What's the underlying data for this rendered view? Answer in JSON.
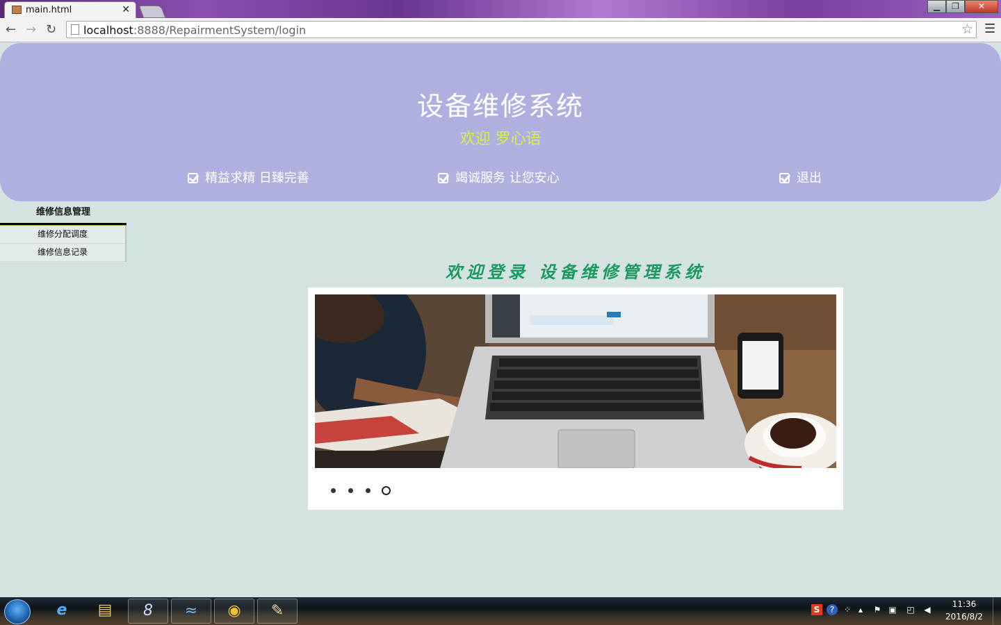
{
  "browser": {
    "tab_title": "main.html",
    "url_host": "localhost",
    "url_rest": ":8888/RepairmentSystem/login"
  },
  "header": {
    "title": "设备维修系统",
    "welcome": "欢迎  罗心语",
    "links": [
      "精益求精  日臻完善",
      "竭诚服务  让您安心",
      "退出"
    ]
  },
  "sidebar": {
    "title": "维修信息管理",
    "items": [
      "维修分配调度",
      "维修信息记录"
    ]
  },
  "main": {
    "heading": "欢迎登录 设备维修管理系统",
    "slider": {
      "dot_count": 4,
      "active_index": 3
    }
  },
  "taskbar": {
    "time": "11:36",
    "date": "2016/8/2"
  },
  "colors": {
    "header_bg": "#b0b0e0",
    "page_bg": "#d4e2e2",
    "welcome_text": "#d6f048",
    "heading_text": "#1a9a5e"
  }
}
